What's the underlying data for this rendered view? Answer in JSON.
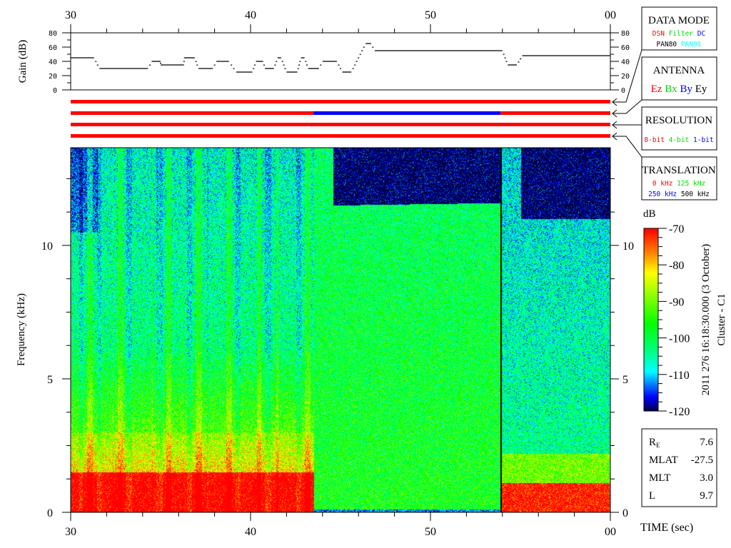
{
  "chart_data": {
    "type": "heatmap",
    "title": "2011 276 16:18:30.000 (3 October)",
    "subtitle": "Cluster - C1",
    "xlabel": "TIME (sec)",
    "ylabel": "Frequency (kHz)",
    "xlim": [
      30,
      60
    ],
    "ylim": [
      0,
      13.66
    ],
    "x_tick_labels": [
      "30",
      "40",
      "50",
      "00"
    ],
    "x_tick_values": [
      30,
      40,
      50,
      60
    ],
    "y_tick_labels": [
      "0",
      "5",
      "10"
    ],
    "y_tick_values": [
      0,
      5,
      10
    ],
    "colorbar": {
      "label": "dB",
      "range": [
        -120,
        -70
      ],
      "tick_labels": [
        "-70",
        "-80",
        "-90",
        "-100",
        "-110",
        "-120"
      ],
      "tick_values": [
        -70,
        -80,
        -90,
        -100,
        -110,
        -120
      ],
      "colors": [
        "#000040",
        "#0000ff",
        "#00ffff",
        "#00ff00",
        "#ffff00",
        "#ff8000",
        "#ff0000"
      ]
    },
    "segments": [
      {
        "t_start": 30,
        "t_end": 43.5,
        "description_level": "intense low-frequency red below 1.5 kHz, yellow to 3 kHz"
      },
      {
        "t_start": 43.5,
        "t_end": 53.9,
        "description_level": "green broadband, dark blue above 11.5 kHz"
      },
      {
        "t_start": 53.9,
        "t_end": 60,
        "description_level": "blue, red below 1 kHz, dark above 11 kHz"
      }
    ],
    "gain": {
      "ylabel": "Gain (dB)",
      "ylim": [
        0,
        80
      ],
      "tick_labels": [
        "80",
        "60",
        "40",
        "20",
        "0"
      ],
      "tick_values": [
        80,
        60,
        40,
        20,
        0
      ],
      "steps": [
        [
          30,
          31.3,
          45
        ],
        [
          31.6,
          34.3,
          30
        ],
        [
          34.5,
          35.0,
          40
        ],
        [
          35.0,
          36.3,
          35
        ],
        [
          36.3,
          36.9,
          45
        ],
        [
          37.1,
          37.9,
          30
        ],
        [
          38.1,
          38.8,
          40
        ],
        [
          39.2,
          40.1,
          25
        ],
        [
          40.3,
          40.7,
          40
        ],
        [
          40.8,
          41.3,
          30
        ],
        [
          41.5,
          41.7,
          45
        ],
        [
          42.0,
          42.6,
          25
        ],
        [
          42.8,
          43.0,
          45
        ],
        [
          43.2,
          43.8,
          30
        ],
        [
          44.0,
          44.8,
          40
        ],
        [
          45.1,
          45.6,
          25
        ],
        [
          46.4,
          46.7,
          65
        ],
        [
          46.9,
          54.0,
          55
        ],
        [
          54.3,
          54.8,
          35
        ],
        [
          55.1,
          60,
          48
        ]
      ]
    },
    "status_bars": [
      {
        "name": "data mode",
        "segments": [
          [
            30,
            60,
            "#ff0000"
          ]
        ]
      },
      {
        "name": "antenna",
        "segments": [
          [
            30,
            43.5,
            "#ff0000"
          ],
          [
            43.5,
            53.9,
            "#0000ff"
          ],
          [
            53.9,
            60,
            "#ff0000"
          ]
        ]
      },
      {
        "name": "resolution",
        "segments": [
          [
            30,
            60,
            "#ff0000"
          ]
        ]
      },
      {
        "name": "translation",
        "segments": [
          [
            30,
            60,
            "#ff0000"
          ]
        ]
      }
    ]
  },
  "legend": {
    "data_mode": {
      "title": "DATA MODE",
      "items": [
        {
          "label": "DSN",
          "color": "#ff0000"
        },
        {
          "label": "Filter",
          "color": "#00dd00"
        },
        {
          "label": "DC",
          "color": "#0000ff"
        },
        {
          "label": "PAN80",
          "color": "#000000"
        },
        {
          "label": "PAN81",
          "color": "#00ffff"
        }
      ]
    },
    "antenna": {
      "title": "ANTENNA",
      "items": [
        {
          "label": "Ez",
          "color": "#ff0000"
        },
        {
          "label": "Bx",
          "color": "#00dd00"
        },
        {
          "label": "By",
          "color": "#0000ff"
        },
        {
          "label": "Ey",
          "color": "#000000"
        }
      ]
    },
    "resolution": {
      "title": "RESOLUTION",
      "items": [
        {
          "label": "8-bit",
          "color": "#ff0000"
        },
        {
          "label": "4-bit",
          "color": "#00dd00"
        },
        {
          "label": "1-bit",
          "color": "#0000ff"
        }
      ]
    },
    "translation": {
      "title": "TRANSLATION",
      "items": [
        {
          "label": "0 kHz",
          "color": "#ff0000"
        },
        {
          "label": "125 kHz",
          "color": "#00dd00"
        },
        {
          "label": "250 kHz",
          "color": "#0000ff"
        },
        {
          "label": "500 kHz",
          "color": "#000000"
        }
      ]
    }
  },
  "orbit": {
    "rows": [
      {
        "label": "R",
        "sub": "E",
        "value": "7.6"
      },
      {
        "label": "MLAT",
        "sub": "",
        "value": "-27.5"
      },
      {
        "label": "MLT",
        "sub": "",
        "value": "3.0"
      },
      {
        "label": "L",
        "sub": "",
        "value": "9.7"
      }
    ]
  }
}
